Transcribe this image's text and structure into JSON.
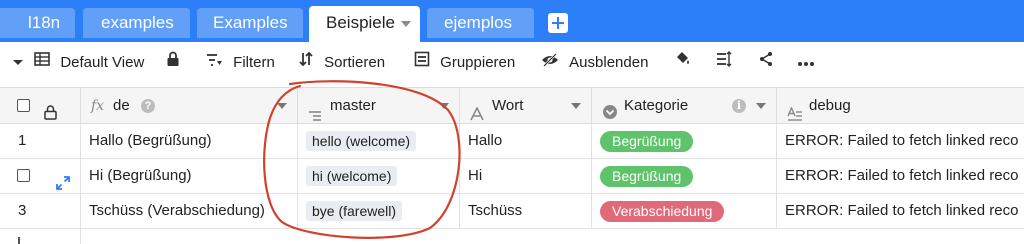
{
  "tabs": [
    {
      "label": "l18n"
    },
    {
      "label": "examples"
    },
    {
      "label": "Examples"
    },
    {
      "label": "Beispiele"
    },
    {
      "label": "ejemplos"
    }
  ],
  "toolbar": {
    "view_label": "Default View",
    "filter_label": "Filtern",
    "sort_label": "Sortieren",
    "group_label": "Gruppieren",
    "hide_label": "Ausblenden"
  },
  "columns": {
    "de": "de",
    "master": "master",
    "wort": "Wort",
    "kategorie": "Kategorie",
    "debug": "debug"
  },
  "rows": [
    {
      "num": "1",
      "de": "Hallo (Begrüßung)",
      "master": "hello (welcome)",
      "wort": "Hallo",
      "kategorie": "Begrüßung",
      "debug": "ERROR: Failed to fetch linked reco"
    },
    {
      "num": "",
      "de": "Hi (Begrüßung)",
      "master": "hi (welcome)",
      "wort": "Hi",
      "kategorie": "Begrüßung",
      "debug": "ERROR: Failed to fetch linked reco"
    },
    {
      "num": "3",
      "de": "Tschüss (Verabschiedung)",
      "master": "bye (farewell)",
      "wort": "Tschüss",
      "kategorie": "Verabschiedung",
      "debug": "ERROR: Failed to fetch linked reco"
    }
  ],
  "colors": {
    "tabbar": "#2d7ff9",
    "category_greeting": "#5ec36a",
    "category_farewell": "#e06a78",
    "annotation": "#d0422b"
  }
}
